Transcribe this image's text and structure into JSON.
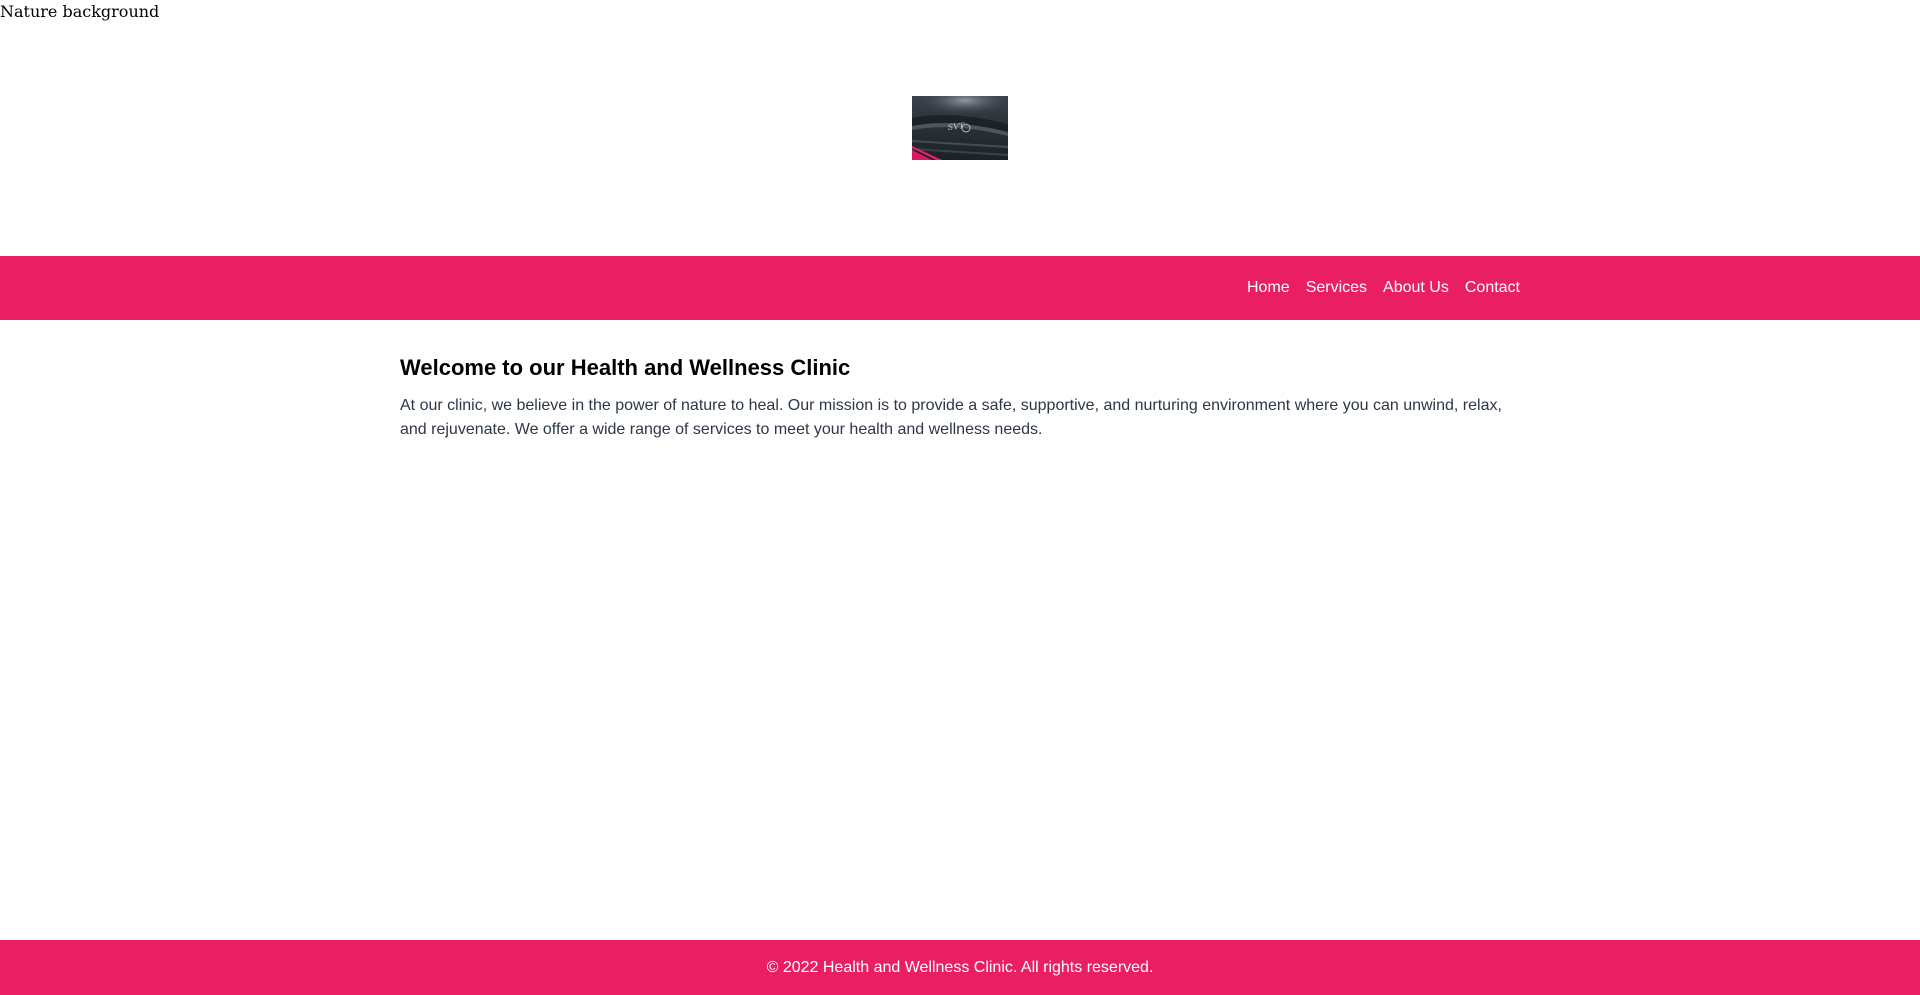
{
  "hero": {
    "background_alt": "Nature background"
  },
  "logo": {
    "icon": "sports-car-badge-photo"
  },
  "nav": {
    "items": [
      {
        "label": "Home"
      },
      {
        "label": "Services"
      },
      {
        "label": "About Us"
      },
      {
        "label": "Contact"
      }
    ]
  },
  "main": {
    "title": "Welcome to our Health and Wellness Clinic",
    "intro": "At our clinic, we believe in the power of nature to heal. Our mission is to provide a safe, supportive, and nurturing environment where you can unwind, relax, and rejuvenate. We offer a wide range of services to meet your health and wellness needs."
  },
  "footer": {
    "text": "© 2022 Health and Wellness Clinic. All rights reserved."
  },
  "colors": {
    "brand": "#e91e63",
    "body_text": "#2d3748",
    "heading": "#000000"
  }
}
